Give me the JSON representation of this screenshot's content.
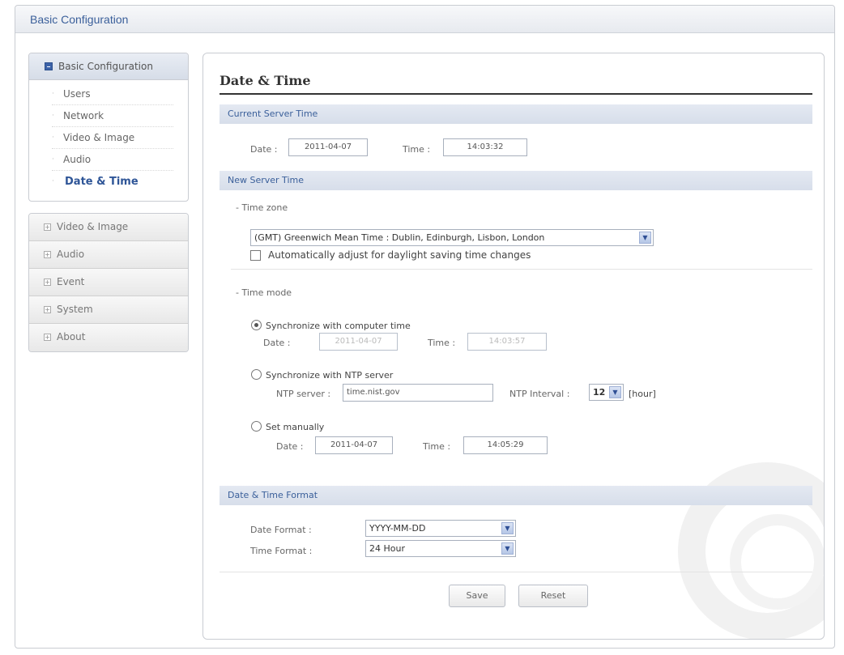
{
  "header": {
    "title": "Basic Configuration"
  },
  "sidebar": {
    "group_title": "Basic Configuration",
    "sub_items": [
      {
        "label": "Users"
      },
      {
        "label": "Network"
      },
      {
        "label": "Video & Image"
      },
      {
        "label": "Audio"
      },
      {
        "label": "Date & Time"
      }
    ],
    "menu": [
      {
        "label": "Video & Image"
      },
      {
        "label": "Audio"
      },
      {
        "label": "Event"
      },
      {
        "label": "System"
      },
      {
        "label": "About"
      }
    ]
  },
  "main": {
    "title": "Date & Time",
    "current": {
      "heading": "Current Server Time",
      "date_label": "Date :",
      "date_value": "2011-04-07",
      "time_label": "Time :",
      "time_value": "14:03:32"
    },
    "new": {
      "heading": "New Server Time",
      "timezone_label": "- Time zone",
      "timezone_value": "(GMT) Greenwich Mean Time : Dublin, Edinburgh, Lisbon, London",
      "dst_label": "Automatically adjust for daylight saving time changes",
      "timemode_label": "- Time mode",
      "sync_computer": {
        "label": "Synchronize with computer time",
        "date_label": "Date :",
        "date_value": "2011-04-07",
        "time_label": "Time :",
        "time_value": "14:03:57"
      },
      "sync_ntp": {
        "label": "Synchronize with NTP server",
        "server_label": "NTP server :",
        "server_value": "time.nist.gov",
        "interval_label": "NTP Interval :",
        "interval_value": "12",
        "interval_unit": "[hour]"
      },
      "manual": {
        "label": "Set manually",
        "date_label": "Date :",
        "date_value": "2011-04-07",
        "time_label": "Time :",
        "time_value": "14:05:29"
      }
    },
    "format": {
      "heading": "Date & Time Format",
      "date_format_label": "Date Format :",
      "date_format_value": "YYYY-MM-DD",
      "time_format_label": "Time Format :",
      "time_format_value": "24 Hour"
    },
    "buttons": {
      "save": "Save",
      "reset": "Reset"
    }
  }
}
